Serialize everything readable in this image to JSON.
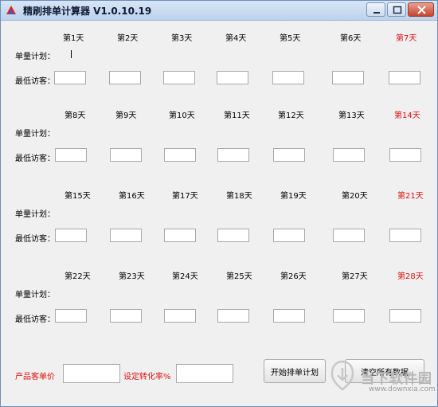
{
  "window": {
    "title": "精刷排单计算器  V1.0.10.19"
  },
  "rows": [
    {
      "days": [
        "第1天",
        "第2天",
        "第3天",
        "第4天",
        "第5天",
        "第6天",
        "第7天"
      ]
    },
    {
      "days": [
        "第8天",
        "第9天",
        "第10天",
        "第11天",
        "第12天",
        "第13天",
        "第14天"
      ]
    },
    {
      "days": [
        "第15天",
        "第16天",
        "第17天",
        "第18天",
        "第19天",
        "第20天",
        "第21天"
      ]
    },
    {
      "days": [
        "第22天",
        "第23天",
        "第24天",
        "第25天",
        "第26天",
        "第27天",
        "第28天"
      ]
    }
  ],
  "labels": {
    "plan": "单量计划：",
    "min_visitors": "最低访客："
  },
  "bottom": {
    "unit_price_label": "产品客单价",
    "conversion_label": "设定转化率%",
    "start_button": "开始排单计划",
    "clear_button": "清空所有数据"
  },
  "watermark": {
    "text": "当下软件园",
    "url": "www.downxia.com"
  },
  "colors": {
    "weekend": "#e01010",
    "titlebar": "#bcd2ec"
  }
}
